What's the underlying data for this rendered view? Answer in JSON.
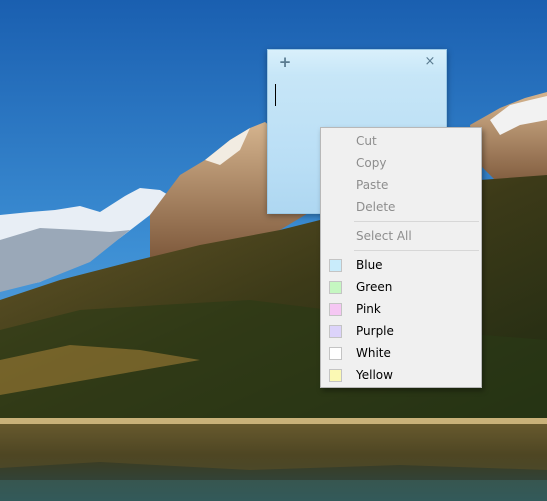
{
  "note": {
    "add_glyph": "+",
    "close_glyph": "×"
  },
  "context_menu": {
    "edit_items": [
      {
        "label": "Cut",
        "enabled": false
      },
      {
        "label": "Copy",
        "enabled": false
      },
      {
        "label": "Paste",
        "enabled": false
      },
      {
        "label": "Delete",
        "enabled": false
      }
    ],
    "select_all": {
      "label": "Select All",
      "enabled": false
    },
    "colors": [
      {
        "label": "Blue",
        "swatch": "#c9ecfb"
      },
      {
        "label": "Green",
        "swatch": "#c5f7c1"
      },
      {
        "label": "Pink",
        "swatch": "#f5c7f3"
      },
      {
        "label": "Purple",
        "swatch": "#dcd3fa"
      },
      {
        "label": "White",
        "swatch": "#ffffff"
      },
      {
        "label": "Yellow",
        "swatch": "#fbf9b4"
      }
    ]
  },
  "theme": {
    "note_color": "#c6e6f8",
    "menu_bg": "#f0f0f0",
    "disabled_text": "#8d8d8d"
  }
}
